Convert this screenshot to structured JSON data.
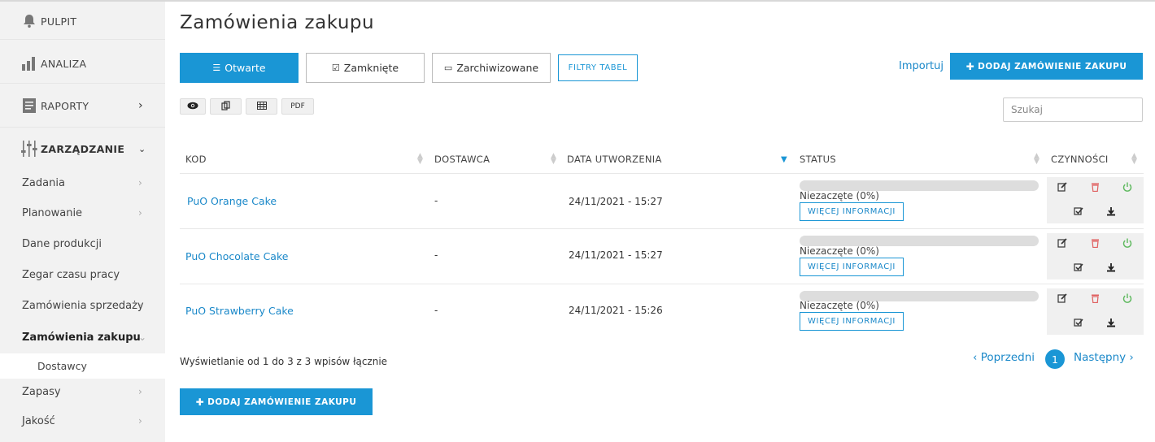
{
  "sidebar": {
    "main_items": [
      {
        "label": "PULPIT",
        "icon": "bell-icon"
      },
      {
        "label": "ANALIZA",
        "icon": "bar-chart-icon"
      },
      {
        "label": "RAPORTY",
        "icon": "report-icon"
      },
      {
        "label": "ZARZĄDZANIE",
        "icon": "sliders-icon"
      }
    ],
    "sub_items": [
      {
        "label": "Zadania"
      },
      {
        "label": "Planowanie"
      },
      {
        "label": "Dane produkcji"
      },
      {
        "label": "Zegar czasu pracy"
      },
      {
        "label": "Zamówienia sprzedaży"
      },
      {
        "label": "Zamówienia zakupu"
      },
      {
        "label": "Dostawcy"
      },
      {
        "label": "Zapasy"
      },
      {
        "label": "Jakość"
      }
    ]
  },
  "page": {
    "title": "Zamówienia zakupu",
    "tabs": [
      "Otwarte",
      "Zamknięte",
      "Zarchiwizowane"
    ],
    "filter_label": "FILTRY TABEL",
    "import_label": "Importuj",
    "add_label": "DODAJ ZAMÓWIENIE ZAKUPU",
    "export_buttons": [
      "PDF"
    ],
    "search_placeholder": "Szukaj"
  },
  "table": {
    "headers": [
      "KOD",
      "DOSTAWCA",
      "DATA UTWORZENIA",
      "STATUS",
      "CZYNNOŚCI"
    ],
    "rows": [
      {
        "code": "PuO Orange Cake",
        "supplier": "-",
        "created": "24/11/2021 - 15:27",
        "status": "Niezaczęte (0%)",
        "progress": 0,
        "more": "WIĘCEJ INFORMACJI"
      },
      {
        "code": "PuO Chocolate Cake",
        "supplier": "-",
        "created": "24/11/2021 - 15:27",
        "status": "Niezaczęte (0%)",
        "progress": 0,
        "more": "WIĘCEJ INFORMACJI"
      },
      {
        "code": "PuO Strawberry Cake",
        "supplier": "-",
        "created": "24/11/2021 - 15:26",
        "status": "Niezaczęte (0%)",
        "progress": 0,
        "more": "WIĘCEJ INFORMACJI"
      }
    ]
  },
  "footer": {
    "info": "Wyświetlanie od 1 do 3 z 3 wpisów łącznie",
    "prev": "‹ Poprzedni",
    "page": "1",
    "next": "Następny ›"
  },
  "colors": {
    "accent": "#1a96d5",
    "delete": "#e06060",
    "power": "#5cb85c"
  }
}
